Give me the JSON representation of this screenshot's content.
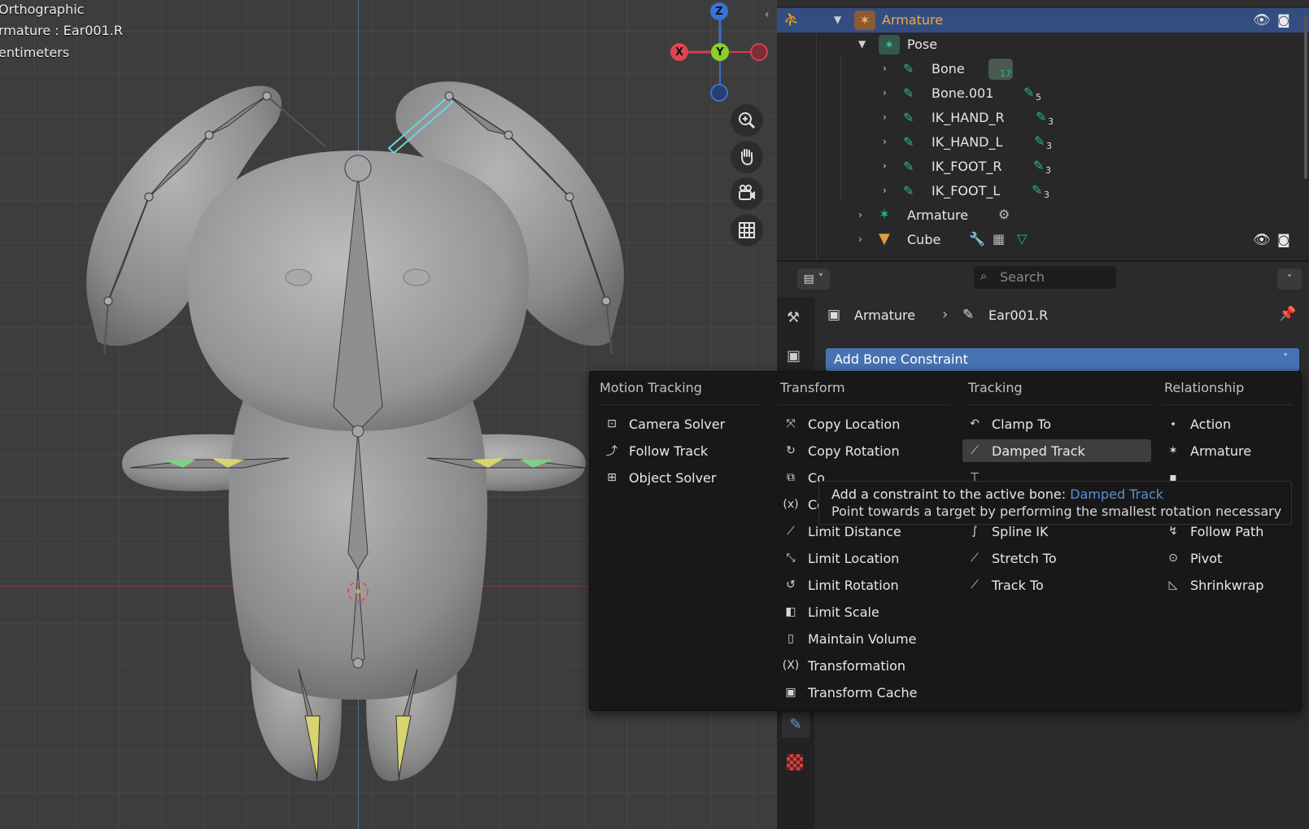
{
  "viewport": {
    "info_lines": [
      "Orthographic",
      "rmature : Ear001.R",
      "entimeters"
    ],
    "gizmo": {
      "z": "Z",
      "y": "Y",
      "x": "X"
    }
  },
  "outliner": {
    "rows": [
      {
        "label": "Armature",
        "badge": ""
      },
      {
        "label": "Pose",
        "badge": ""
      },
      {
        "label": "Bone",
        "badge": "17"
      },
      {
        "label": "Bone.001",
        "badge": "5"
      },
      {
        "label": "IK_HAND_R",
        "badge": "3"
      },
      {
        "label": "IK_HAND_L",
        "badge": "3"
      },
      {
        "label": "IK_FOOT_R",
        "badge": "3"
      },
      {
        "label": "IK_FOOT_L",
        "badge": "3"
      },
      {
        "label": "Armature",
        "badge": ""
      },
      {
        "label": "Cube",
        "badge": ""
      }
    ]
  },
  "properties": {
    "search_placeholder": "Search",
    "breadcrumb_object": "Armature",
    "breadcrumb_bone": "Ear001.R",
    "add_constraint_label": "Add Bone Constraint"
  },
  "menu": {
    "columns": [
      {
        "header": "Motion Tracking",
        "items": [
          "Camera Solver",
          "Follow Track",
          "Object Solver"
        ]
      },
      {
        "header": "Transform",
        "items": [
          "Copy Location",
          "Copy Rotation",
          "Co",
          "Co",
          "Limit Distance",
          "Limit Location",
          "Limit Rotation",
          "Limit Scale",
          "Maintain Volume",
          "Transformation",
          "Transform Cache"
        ]
      },
      {
        "header": "Tracking",
        "items": [
          "Clamp To",
          "Damped Track",
          "",
          "",
          "Spline IK",
          "Stretch To",
          "Track To"
        ]
      },
      {
        "header": "Relationship",
        "items": [
          "Action",
          "Armature",
          "",
          "",
          "Follow Path",
          "Pivot",
          "Shrinkwrap"
        ]
      }
    ],
    "highlighted": "Damped Track"
  },
  "tooltip": {
    "prefix": "Add a constraint to the active bone:",
    "name": "Damped Track",
    "description": "Point towards a target by performing the smallest rotation necessary"
  },
  "colors": {
    "selection": "#334d80",
    "accent_blue": "#4772b3",
    "bone_green": "#2fb58a",
    "armature_orange": "#e59b3d",
    "tooltip_link": "#5f8dd3"
  }
}
